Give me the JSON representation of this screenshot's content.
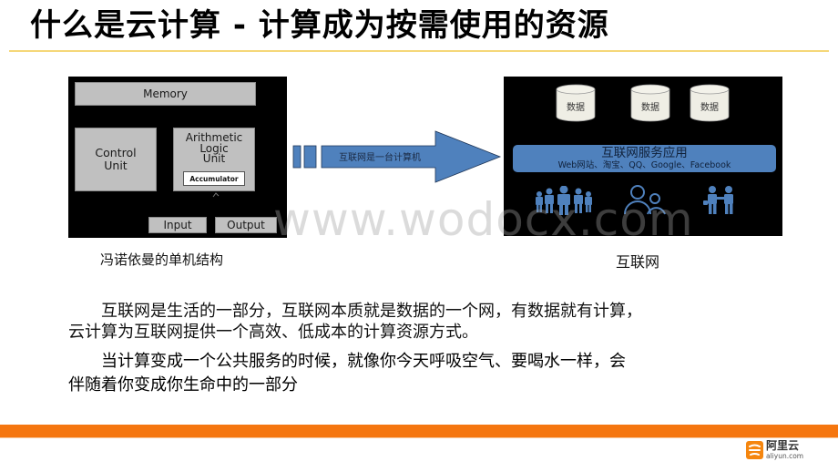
{
  "slide": {
    "title": "什么是云计算 - 计算成为按需使用的资源",
    "colors": {
      "title_rule": "#f5d778",
      "footer_bar": "#f5760f",
      "arrow_fill": "#4f81bd",
      "service_bar": "#4f81bd",
      "people_icons": "#4f81bd",
      "diagram_bg": "#000000",
      "db_fill": "#efeee5"
    }
  },
  "von_neumann": {
    "memory": "Memory",
    "control_unit": [
      "Control",
      "Unit"
    ],
    "alu": [
      "Arithmetic",
      "Logic",
      "Unit"
    ],
    "accumulator": "Accumulator",
    "input": "Input",
    "output": "Output",
    "caption": "冯诺依曼的单机结构"
  },
  "arrow": {
    "label": "互联网是一台计算机"
  },
  "internet": {
    "databases": [
      "数据",
      "数据",
      "数据"
    ],
    "service_title": "互联网服务应用",
    "service_examples": "Web网站、淘宝、QQ、Google、Facebook",
    "icons": [
      "group-people-icon",
      "users-outline-icon",
      "handshake-people-icon"
    ],
    "caption": "互联网"
  },
  "body": {
    "paragraph1_line1": "　　互联网是生活的一部分，互联网本质就是数据的一个网，有数据就有计算，",
    "paragraph1_line2": "云计算为互联网提供一个高效、低成本的计算资源方式。",
    "paragraph2_line1": "　　当计算变成一个公共服务的时候，就像你今天呼吸空气、要喝水一样，会",
    "paragraph2_line2": "伴随着你变成你生命中的一部分"
  },
  "watermark": "www.wodocx.com",
  "footer": {
    "logo_cn": "阿里云",
    "logo_en": "aliyun.com"
  }
}
